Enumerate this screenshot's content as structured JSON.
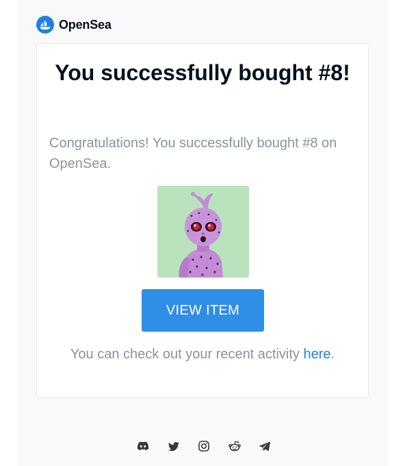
{
  "brand": {
    "name": "OpenSea",
    "logo_icon": "opensea-logo-icon",
    "accent_color": "#2081e2"
  },
  "email": {
    "headline": "You successfully bought #8!",
    "message": "Congratulations! You successfully bought #8 on OpenSea.",
    "nft_image": {
      "icon": "nft-alien-image",
      "background_color": "#b9e3bd"
    },
    "button": {
      "label": "VIEW ITEM",
      "color": "#2f8ee5"
    },
    "activity": {
      "text_before": "You can check out your recent activity ",
      "link_text": "here",
      "text_after": "."
    }
  },
  "footer": {
    "social_icons": [
      "discord-icon",
      "twitter-icon",
      "instagram-icon",
      "reddit-icon",
      "telegram-icon"
    ]
  }
}
